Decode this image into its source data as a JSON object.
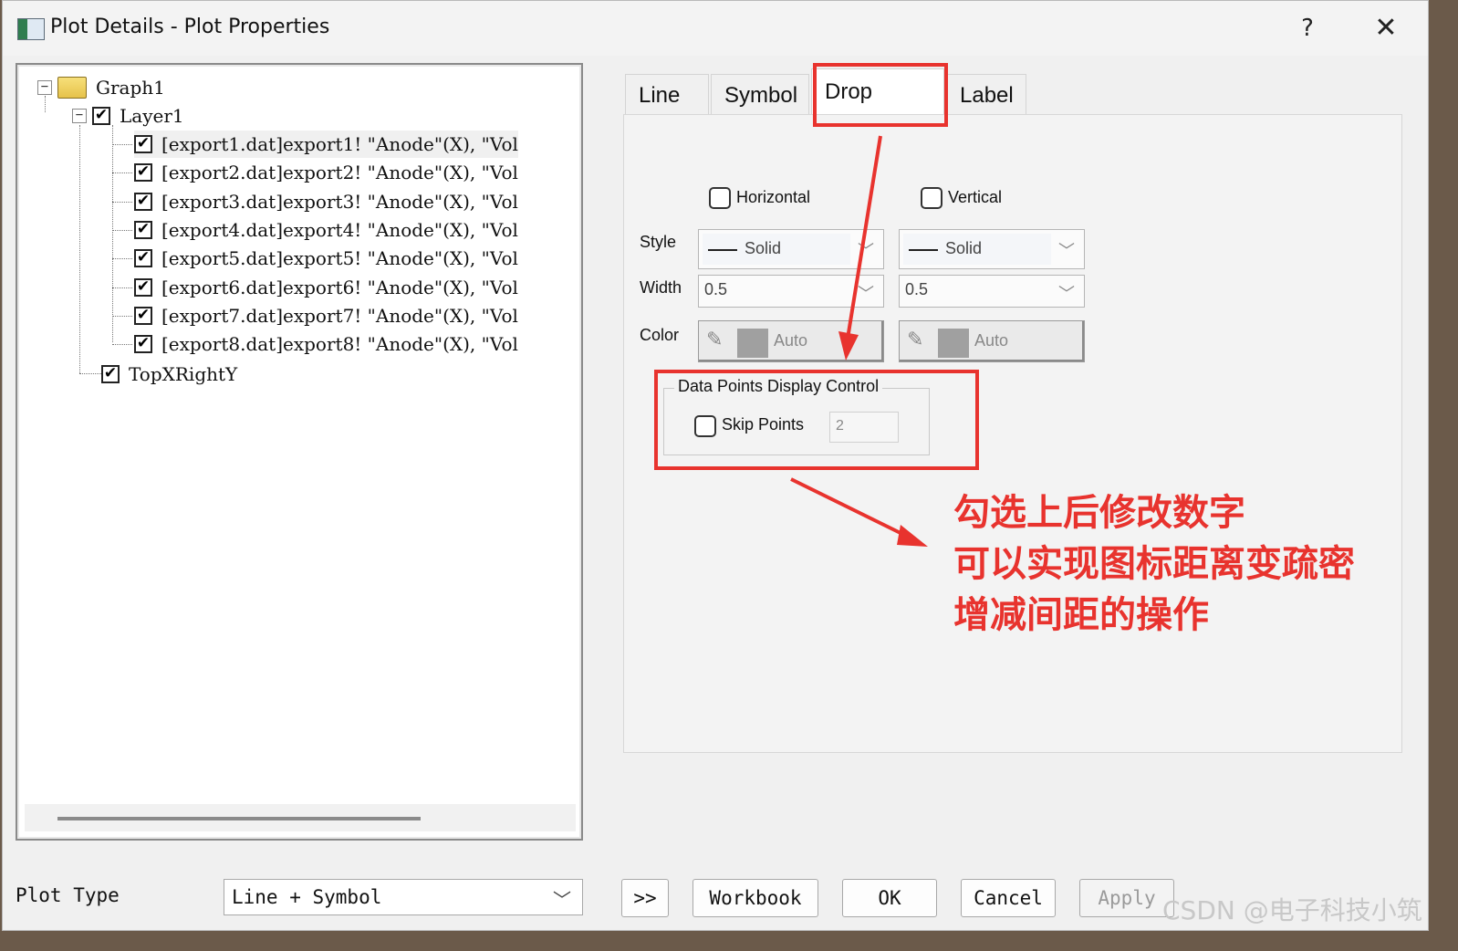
{
  "window": {
    "title": "Plot Details - Plot Properties",
    "help": "?",
    "close": "✕"
  },
  "tree": {
    "root": "Graph1",
    "layer": "Layer1",
    "items": [
      "[export1.dat]export1! \"Anode\"(X), \"Vol",
      "[export2.dat]export2! \"Anode\"(X), \"Vol",
      "[export3.dat]export3! \"Anode\"(X), \"Vol",
      "[export4.dat]export4! \"Anode\"(X), \"Vol",
      "[export5.dat]export5! \"Anode\"(X), \"Vol",
      "[export6.dat]export6! \"Anode\"(X), \"Vol",
      "[export7.dat]export7! \"Anode\"(X), \"Vol",
      "[export8.dat]export8! \"Anode\"(X), \"Vol"
    ],
    "extra_layer": "TopXRightY",
    "expander_minus": "−",
    "check_mark": "✔"
  },
  "tabs": [
    {
      "label": "Line"
    },
    {
      "label": "Symbol"
    },
    {
      "label": "Drop Lines"
    },
    {
      "label": "Label"
    }
  ],
  "drop_lines": {
    "horizontal_label": "Horizontal",
    "vertical_label": "Vertical",
    "style_label": "Style",
    "width_label": "Width",
    "color_label": "Color",
    "h_style": "Solid",
    "v_style": "Solid",
    "h_width": "0.5",
    "v_width": "0.5",
    "h_color": "Auto",
    "v_color": "Auto",
    "combo_arrow": "﹀",
    "pen_icon": "✎"
  },
  "data_points": {
    "title": "Data Points Display Control",
    "skip_label": "Skip Points",
    "skip_value": "2"
  },
  "annotation": {
    "line1": "勾选上后修改数字",
    "line2": "可以实现图标距离变疏密",
    "line3": "增减间距的操作",
    "color": "#e8332e"
  },
  "bottom": {
    "plot_type_label": "Plot Type",
    "plot_type_value": "Line + Symbol",
    "expand_btn": ">>",
    "workbook_btn": "Workbook",
    "ok_btn": "OK",
    "cancel_btn": "Cancel",
    "apply_btn": "Apply"
  },
  "watermark": "CSDN @电子科技小筑"
}
